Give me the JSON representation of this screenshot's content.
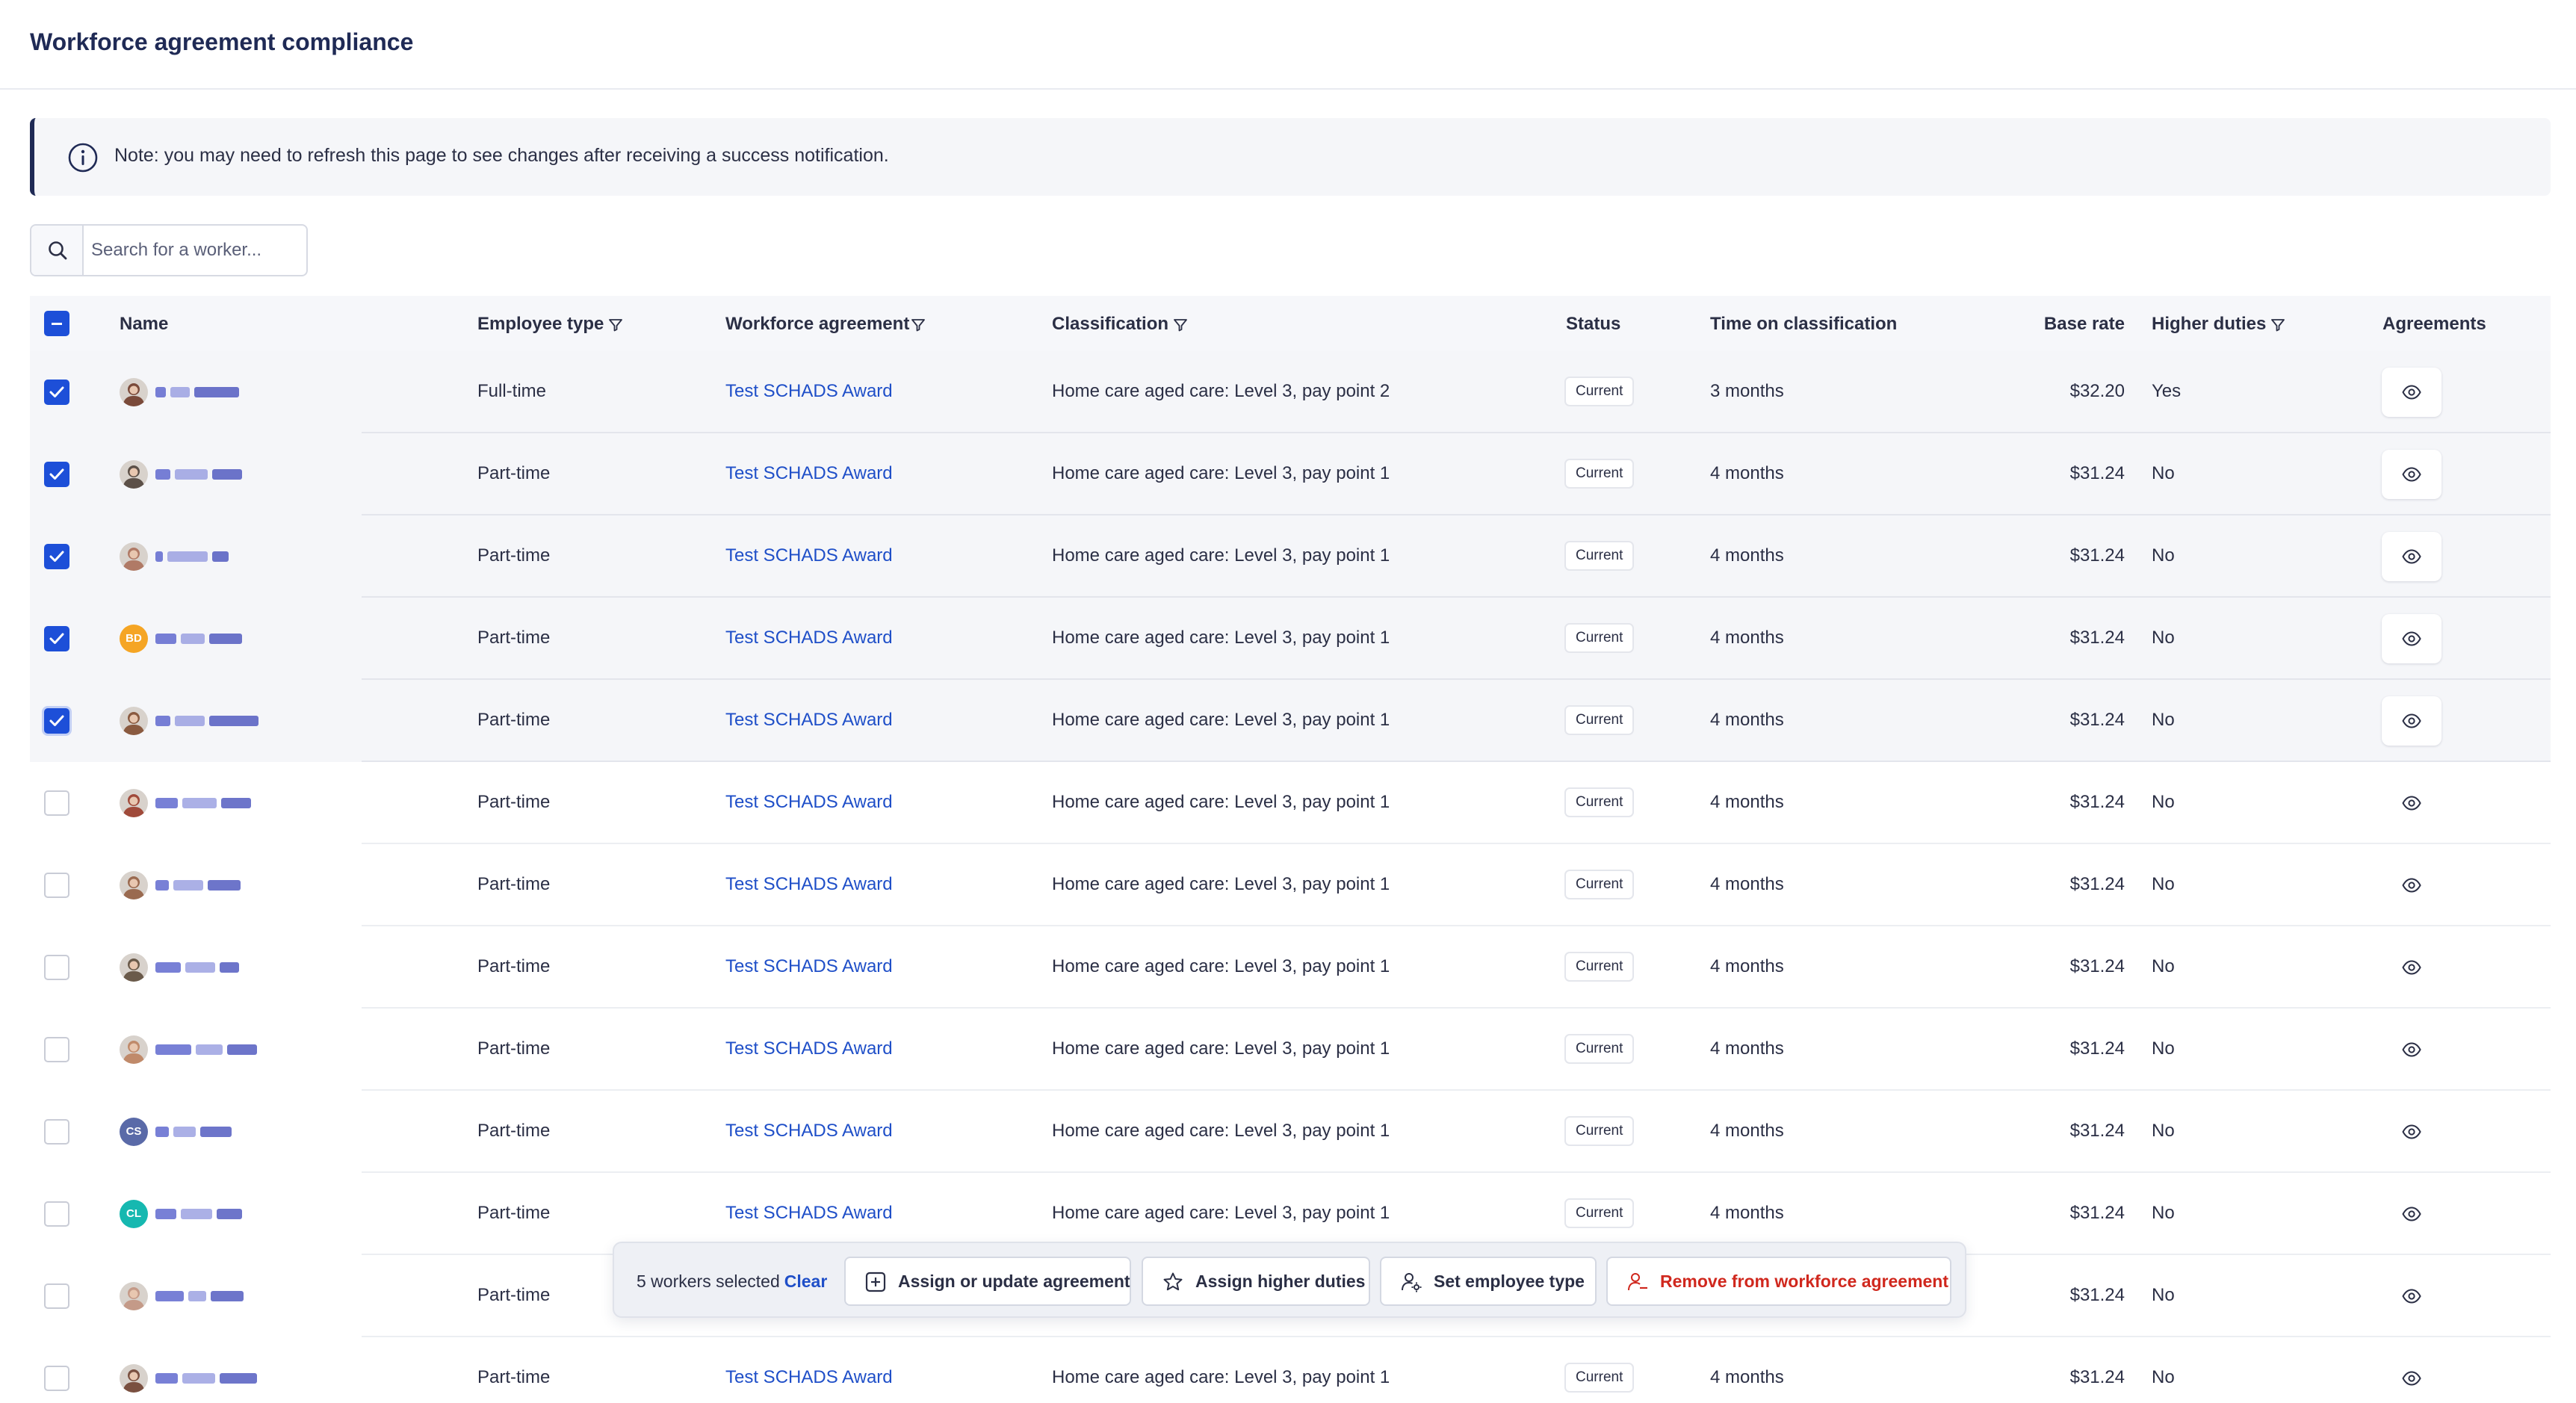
{
  "page": {
    "title": "Workforce agreement compliance"
  },
  "note": {
    "text": "Note: you may need to refresh this page to see changes after receiving a success notification."
  },
  "search": {
    "placeholder": "Search for a worker..."
  },
  "table": {
    "headers": {
      "name": "Name",
      "employee_type": "Employee type",
      "workforce_agreement": "Workforce agreement",
      "classification": "Classification",
      "status": "Status",
      "time_on_classification": "Time on classification",
      "base_rate": "Base rate",
      "higher_duties": "Higher duties",
      "agreements": "Agreements"
    },
    "rows": [
      {
        "selected": true,
        "avatar": "photo",
        "initials": "",
        "avatar_color": "#7a4a3a",
        "employee_type": "Full-time",
        "agreement": "Test SCHADS Award",
        "classification": "Home care aged care: Level 3, pay point 2",
        "status": "Current",
        "time": "3 months",
        "rate": "$32.20",
        "higher_duties": "Yes"
      },
      {
        "selected": true,
        "avatar": "photo",
        "initials": "",
        "avatar_color": "#5c5048",
        "employee_type": "Part-time",
        "agreement": "Test SCHADS Award",
        "classification": "Home care aged care: Level 3, pay point 1",
        "status": "Current",
        "time": "4 months",
        "rate": "$31.24",
        "higher_duties": "No"
      },
      {
        "selected": true,
        "avatar": "photo",
        "initials": "",
        "avatar_color": "#b07a66",
        "employee_type": "Part-time",
        "agreement": "Test SCHADS Award",
        "classification": "Home care aged care: Level 3, pay point 1",
        "status": "Current",
        "time": "4 months",
        "rate": "$31.24",
        "higher_duties": "No"
      },
      {
        "selected": true,
        "avatar": "initials",
        "initials": "BD",
        "avatar_color": "#f5a524",
        "employee_type": "Part-time",
        "agreement": "Test SCHADS Award",
        "classification": "Home care aged care: Level 3, pay point 1",
        "status": "Current",
        "time": "4 months",
        "rate": "$31.24",
        "higher_duties": "No"
      },
      {
        "selected": true,
        "avatar": "photo",
        "initials": "",
        "avatar_color": "#8a5a40",
        "employee_type": "Part-time",
        "agreement": "Test SCHADS Award",
        "classification": "Home care aged care: Level 3, pay point 1",
        "status": "Current",
        "time": "4 months",
        "rate": "$31.24",
        "higher_duties": "No"
      },
      {
        "selected": false,
        "avatar": "photo",
        "initials": "",
        "avatar_color": "#a04a3a",
        "employee_type": "Part-time",
        "agreement": "Test SCHADS Award",
        "classification": "Home care aged care: Level 3, pay point 1",
        "status": "Current",
        "time": "4 months",
        "rate": "$31.24",
        "higher_duties": "No"
      },
      {
        "selected": false,
        "avatar": "photo",
        "initials": "",
        "avatar_color": "#9a6a50",
        "employee_type": "Part-time",
        "agreement": "Test SCHADS Award",
        "classification": "Home care aged care: Level 3, pay point 1",
        "status": "Current",
        "time": "4 months",
        "rate": "$31.24",
        "higher_duties": "No"
      },
      {
        "selected": false,
        "avatar": "photo",
        "initials": "",
        "avatar_color": "#6a5a4a",
        "employee_type": "Part-time",
        "agreement": "Test SCHADS Award",
        "classification": "Home care aged care: Level 3, pay point 1",
        "status": "Current",
        "time": "4 months",
        "rate": "$31.24",
        "higher_duties": "No"
      },
      {
        "selected": false,
        "avatar": "photo",
        "initials": "",
        "avatar_color": "#c08a6a",
        "employee_type": "Part-time",
        "agreement": "Test SCHADS Award",
        "classification": "Home care aged care: Level 3, pay point 1",
        "status": "Current",
        "time": "4 months",
        "rate": "$31.24",
        "higher_duties": "No"
      },
      {
        "selected": false,
        "avatar": "initials",
        "initials": "CS",
        "avatar_color": "#5a6aa8",
        "employee_type": "Part-time",
        "agreement": "Test SCHADS Award",
        "classification": "Home care aged care: Level 3, pay point 1",
        "status": "Current",
        "time": "4 months",
        "rate": "$31.24",
        "higher_duties": "No"
      },
      {
        "selected": false,
        "avatar": "initials",
        "initials": "CL",
        "avatar_color": "#16b8b0",
        "employee_type": "Part-time",
        "agreement": "Test SCHADS Award",
        "classification": "Home care aged care: Level 3, pay point 1",
        "status": "Current",
        "time": "4 months",
        "rate": "$31.24",
        "higher_duties": "No"
      },
      {
        "selected": false,
        "avatar": "photo",
        "initials": "",
        "avatar_color": "#c49a88",
        "employee_type": "Part-time",
        "agreement": "",
        "classification": "",
        "status": "",
        "time": "",
        "rate": "$31.24",
        "higher_duties": "No"
      },
      {
        "selected": false,
        "avatar": "photo",
        "initials": "",
        "avatar_color": "#7a5040",
        "employee_type": "Part-time",
        "agreement": "Test SCHADS Award",
        "classification": "Home care aged care: Level 3, pay point 1",
        "status": "Current",
        "time": "4 months",
        "rate": "$31.24",
        "higher_duties": "No"
      }
    ]
  },
  "action_bar": {
    "selected_text": "5 workers selected",
    "clear_label": "Clear",
    "assign_label": "Assign or update agreement",
    "higher_duties_label": "Assign higher duties",
    "employee_type_label": "Set employee type",
    "remove_label": "Remove from workforce agreement"
  },
  "colors": {
    "accent": "#1d4fd8",
    "link": "#1f4fc8",
    "danger": "#d0281e",
    "navy": "#1f2a55"
  }
}
